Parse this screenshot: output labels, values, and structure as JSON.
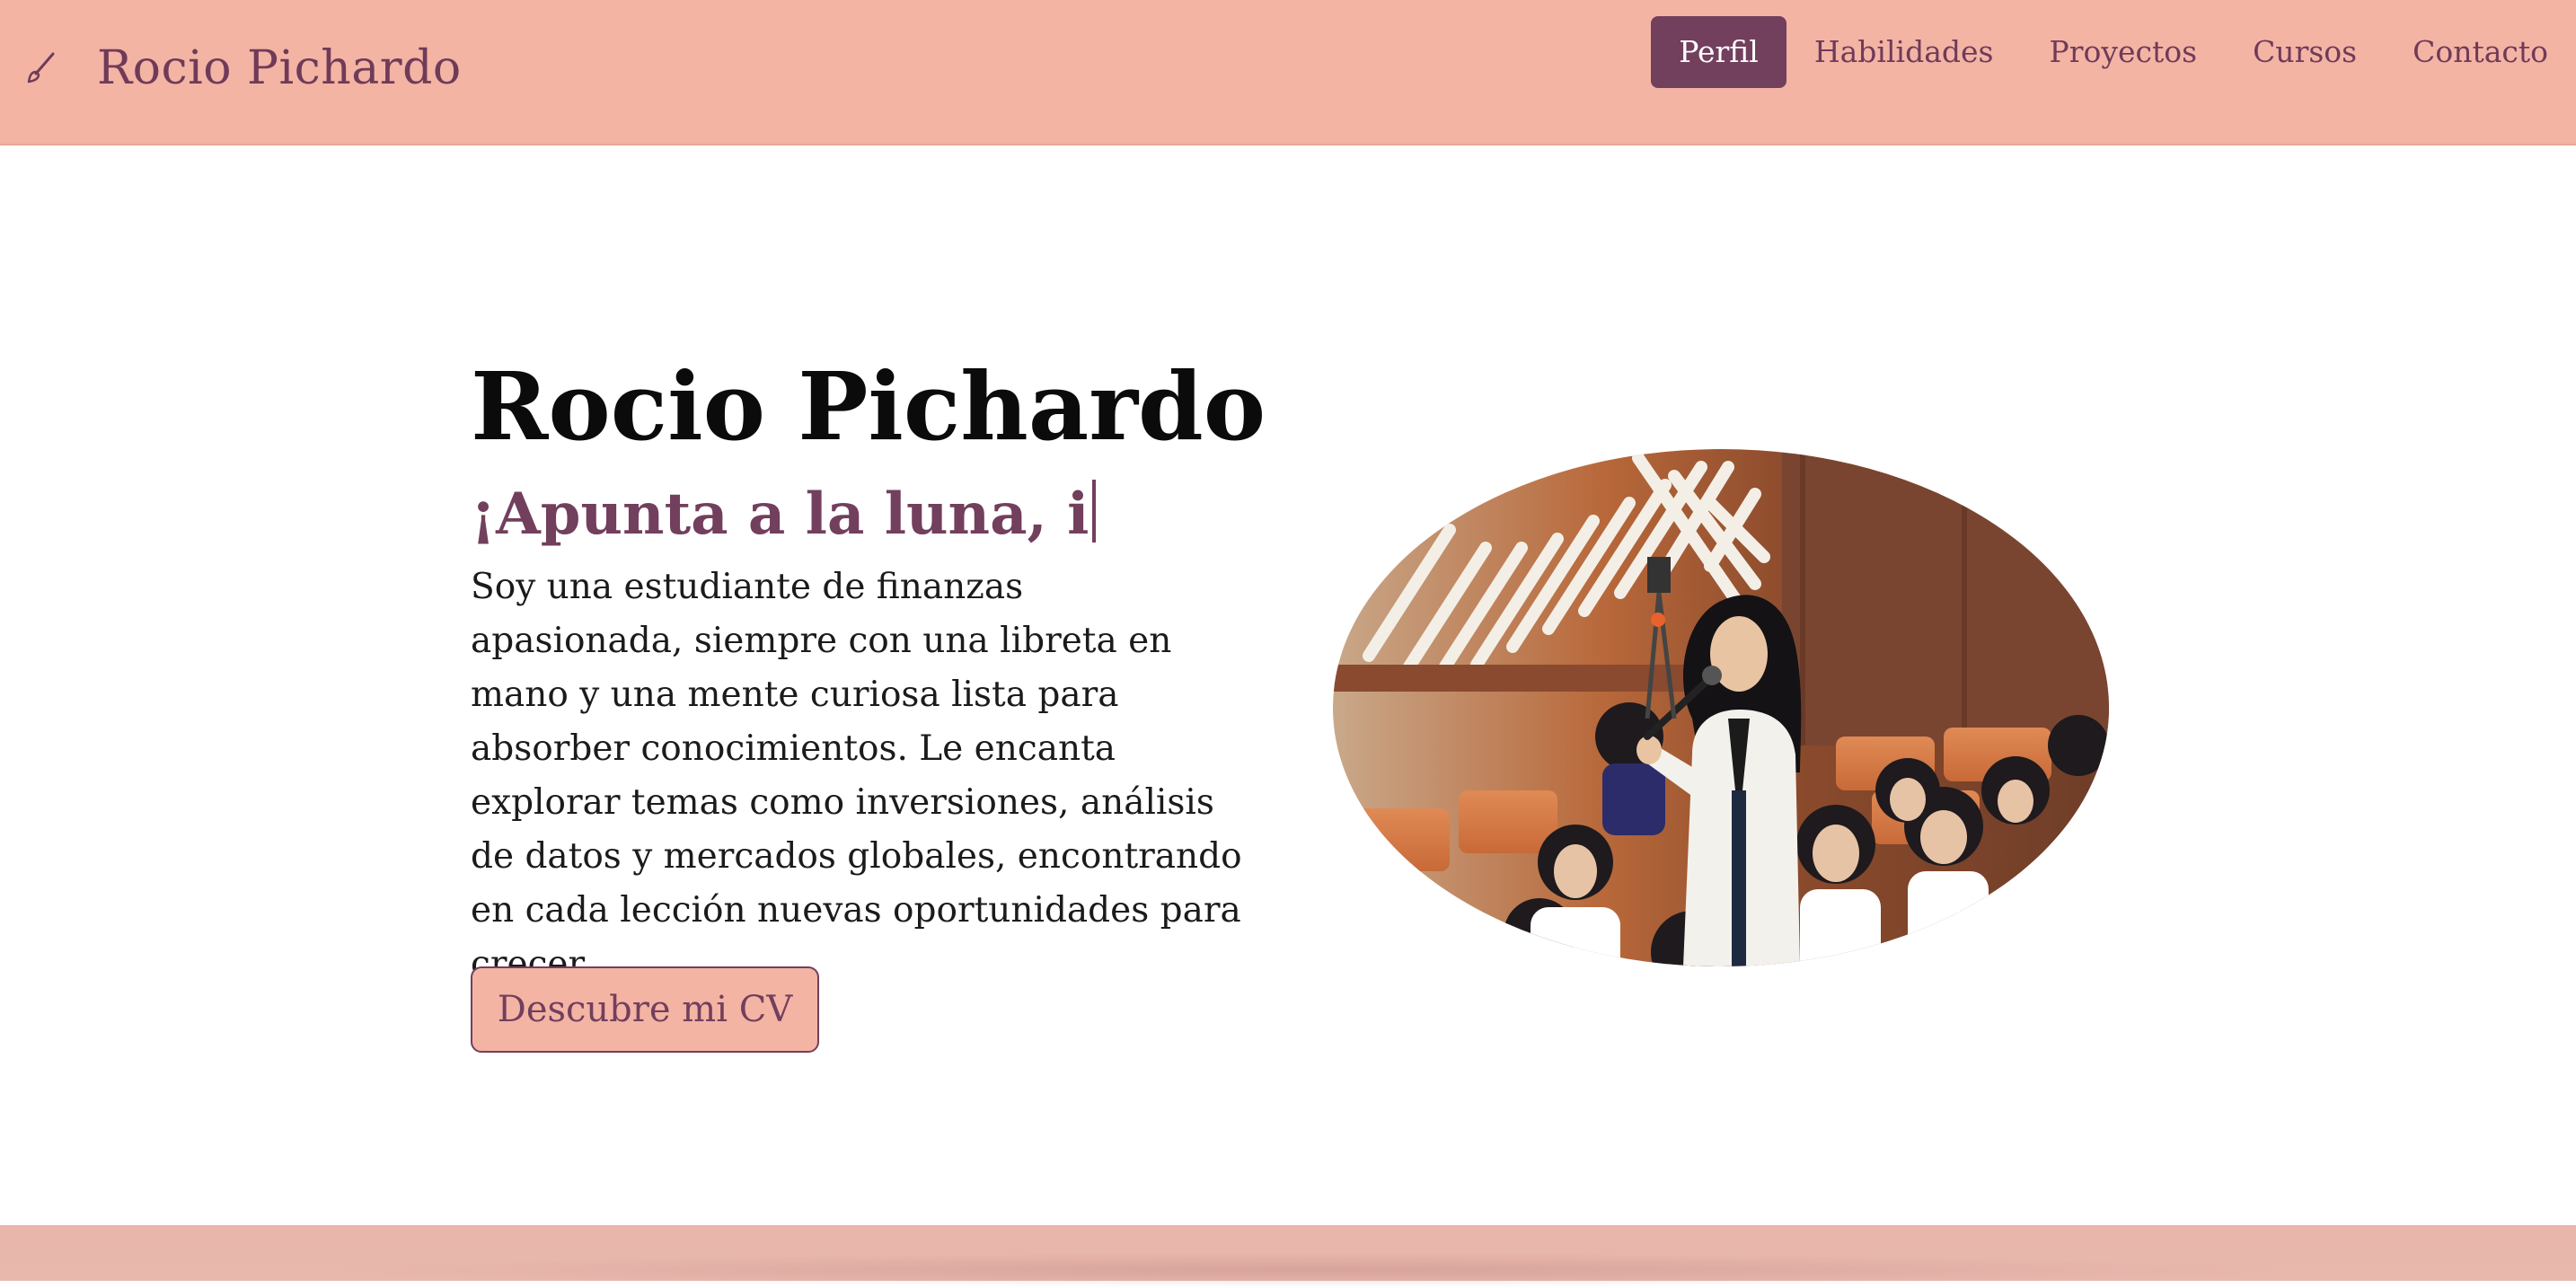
{
  "brand": {
    "name": "Rocio Pichardo",
    "icon": "brush-icon"
  },
  "nav": {
    "items": [
      {
        "label": "Perfil",
        "active": true
      },
      {
        "label": "Habilidades",
        "active": false
      },
      {
        "label": "Proyectos",
        "active": false
      },
      {
        "label": "Cursos",
        "active": false
      },
      {
        "label": "Contacto",
        "active": false
      }
    ]
  },
  "hero": {
    "title": "Rocio Pichardo",
    "subtitle": "¡Apunta a la luna, i",
    "description": "Soy una estudiante de finanzas apasionada, siempre con una libreta en mano y una mente curiosa lista para absorber conocimientos. Le encanta explorar temas como inversiones, análisis de datos y mercados globales, encontrando en cada lección nuevas oportunidades para crecer.",
    "cta_label": "Descubre mi CV",
    "photo": "student-speaking-photo"
  },
  "colors": {
    "header_bg": "#f4b4a4",
    "accent": "#723f5d",
    "button_bg": "#f4b4a4",
    "text": "#0b0b0b"
  }
}
